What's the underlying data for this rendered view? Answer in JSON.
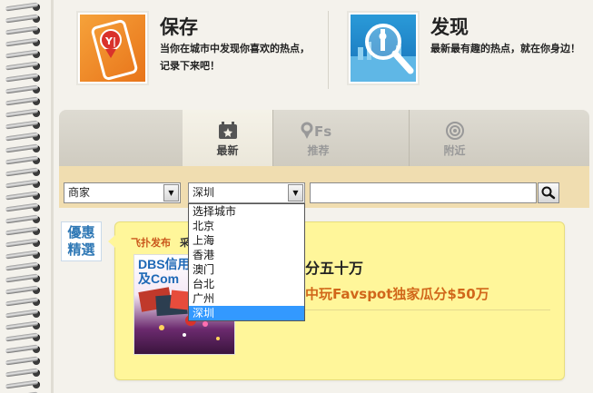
{
  "features": {
    "save": {
      "title": "保存",
      "description": "当你在城市中发现你喜欢的热点，记录下来吧！"
    },
    "discover": {
      "title": "发现",
      "description": "最新最有趣的热点，就在你身边！"
    }
  },
  "tabs": [
    {
      "label": "最新",
      "icon": "calendar-icon",
      "active": true
    },
    {
      "label": "推荐",
      "icon": "foursquare-icon",
      "active": false
    },
    {
      "label": "附近",
      "icon": "target-icon",
      "active": false
    }
  ],
  "filters": {
    "category_value": "商家",
    "city_value": "深圳",
    "search_value": "",
    "city_options": [
      "选择城市",
      "北京",
      "上海",
      "香港",
      "澳门",
      "台北",
      "广州",
      "深圳"
    ],
    "selected_city_index": 7
  },
  "content": {
    "badge": "優惠精選",
    "publisher": "飞扑发布",
    "publisher_suffix": "采",
    "deal": {
      "image_text": "DBS信用\n及Com",
      "title": "分五十万",
      "subtitle": "中玩Favspot独家瓜分$50万"
    }
  },
  "colors": {
    "accent_orange": "#d1671a",
    "badge_blue": "#2f78b5",
    "card_yellow": "#fff69a",
    "filter_bar": "#f0ddb0",
    "dropdown_selected": "#3399ff"
  }
}
